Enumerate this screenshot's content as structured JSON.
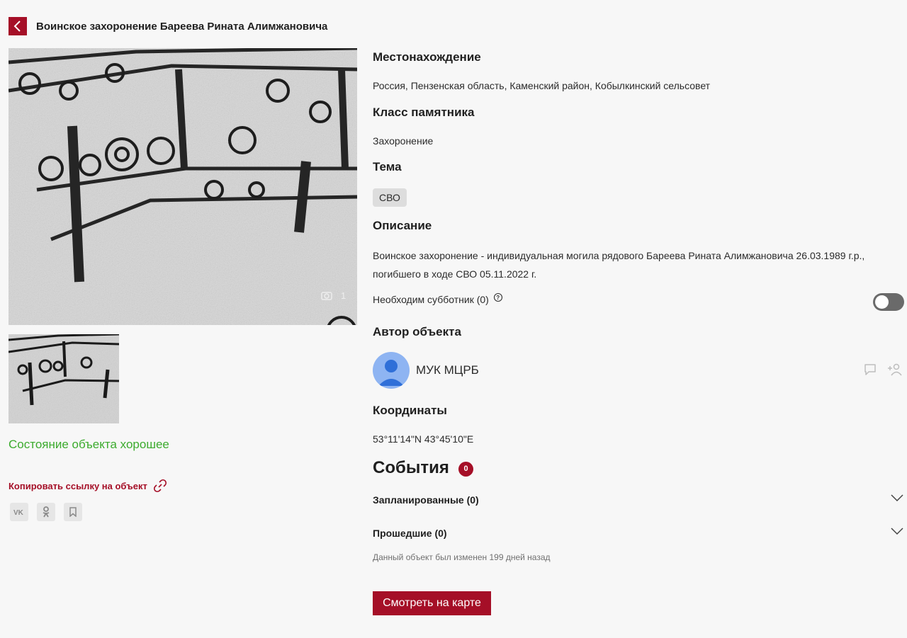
{
  "header": {
    "back_icon": "chevron-left-icon",
    "title": "Воинское захоронение Бареева Рината Алимжановича"
  },
  "gallery": {
    "photo_counter": "1",
    "main_photo_icon": "camera-icon"
  },
  "state_text": "Состояние объекта хорошее",
  "copy_link_label": "Копировать ссылку на объект",
  "share": [
    "vk-icon",
    "odnoklassniki-icon",
    "bookmark-icon"
  ],
  "location": {
    "heading": "Местонахождение",
    "value": "Россия, Пензенская область, Каменский район, Кобылкинский сельсовет"
  },
  "monument_class": {
    "heading": "Класс памятника",
    "value": "Захоронение"
  },
  "theme": {
    "heading": "Тема",
    "tag": "СВО"
  },
  "description": {
    "heading": "Описание",
    "value": "Воинское захоронение - индивидуальная могила рядового Бареева Рината Алимжановича 26.03.1989 г.р., погибшего в ходе СВО 05.11.2022 г."
  },
  "subbotnik": {
    "label": "Необходим субботник (0)",
    "help_icon": "question-circle-icon",
    "enabled": false
  },
  "author": {
    "heading": "Автор объекта",
    "name": "МУК МЦРБ"
  },
  "coordinates": {
    "heading": "Координаты",
    "value": "53°11'14\"N 43°45'10\"E"
  },
  "events": {
    "heading": "События",
    "count": "0",
    "planned": "Запланированные (0)",
    "past": "Прошедшие (0)"
  },
  "modified_note": "Данный объект был изменен 199 дней назад",
  "map_button": "Смотреть на карте",
  "colors": {
    "accent": "#a50f27",
    "status_good": "#3cab2e",
    "background": "#f7f7f7"
  }
}
